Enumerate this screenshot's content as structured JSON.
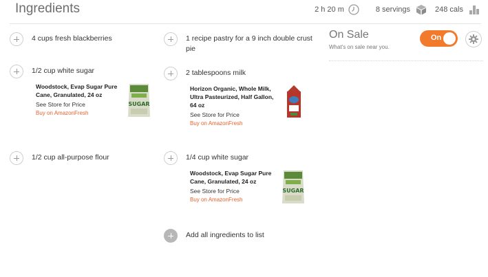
{
  "header": {
    "title": "Ingredients",
    "time": "2 h 20 m",
    "servings": "8 servings",
    "calories": "248 cals"
  },
  "ingredients_left": [
    {
      "text": "4 cups fresh blackberries"
    },
    {
      "text": "1/2 cup white sugar",
      "product": {
        "name": "Woodstock, Evap Sugar Pure Cane, Granulated, 24 oz",
        "price": "See Store for Price",
        "buy": "Buy on AmazonFresh"
      }
    },
    {
      "text": "1/2 cup all-purpose flour"
    }
  ],
  "ingredients_mid": [
    {
      "text": "1 recipe pastry for a 9 inch double crust pie"
    },
    {
      "text": "2 tablespoons milk",
      "product": {
        "name": "Horizon Organic, Whole Milk, Ultra Pasteurized, Half Gallon, 64 oz",
        "price": "See Store for Price",
        "buy": "Buy on AmazonFresh"
      }
    },
    {
      "text": "1/4 cup white sugar",
      "product": {
        "name": "Woodstock, Evap Sugar Pure Cane, Granulated, 24 oz",
        "price": "See Store for Price",
        "buy": "Buy on AmazonFresh"
      }
    },
    {
      "text": "Add all ingredients to list"
    }
  ],
  "on_sale": {
    "title": "On Sale",
    "subtitle": "What's on sale near you.",
    "toggle_label": "On",
    "toggle_state": "on"
  },
  "colors": {
    "accent": "#f17a2d",
    "buy_link": "#e8622d"
  },
  "icons": {
    "time": "clock-icon",
    "servings": "cube-icon",
    "calories": "bar-chart-icon",
    "settings": "gear-icon",
    "add": "plus-icon"
  }
}
